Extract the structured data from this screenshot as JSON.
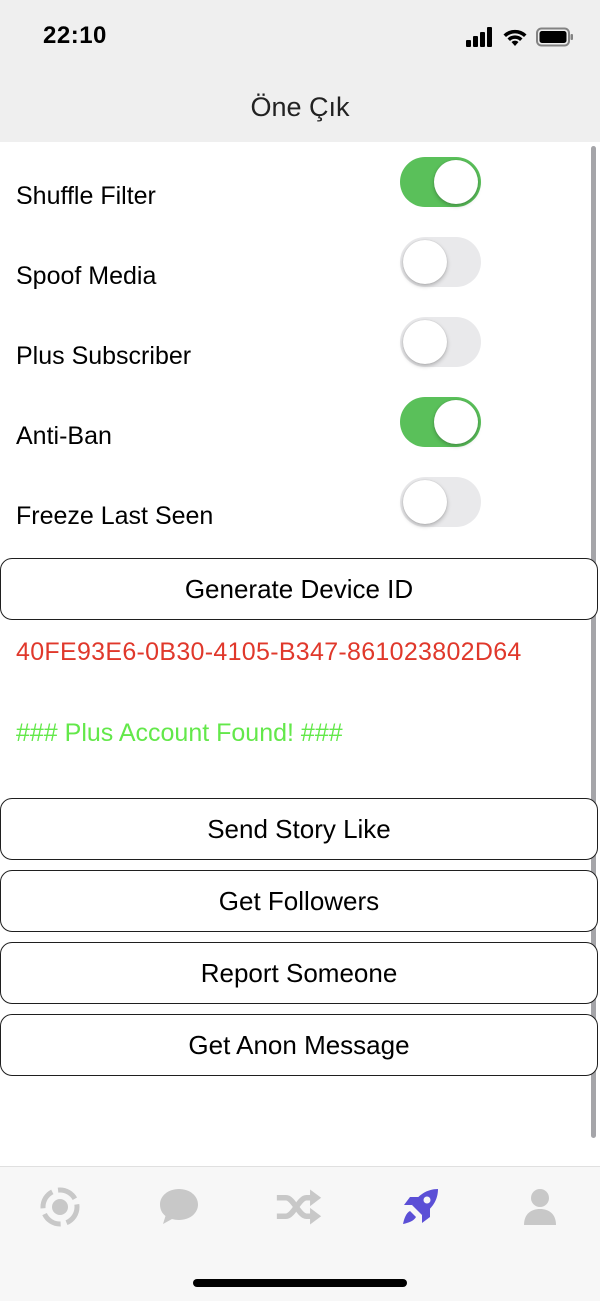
{
  "status": {
    "time": "22:10"
  },
  "nav": {
    "title": "Öne Çık"
  },
  "toggles": [
    {
      "label": "Shuffle Filter",
      "on": true
    },
    {
      "label": "Spoof Media",
      "on": false
    },
    {
      "label": "Plus Subscriber",
      "on": false
    },
    {
      "label": "Anti-Ban",
      "on": true
    },
    {
      "label": "Freeze Last Seen",
      "on": false
    }
  ],
  "generate_button": "Generate Device ID",
  "device_id": "40FE93E6-0B30-4105-B347-861023802D64",
  "plus_status": "### Plus Account Found! ###",
  "actions": {
    "send_story_like": "Send Story Like",
    "get_followers": "Get Followers",
    "report_someone": "Report Someone",
    "get_anon_message": "Get Anon Message"
  },
  "colors": {
    "toggle_on": "#5ac05a",
    "toggle_off": "#e9e9eb",
    "device_id": "#e0382b",
    "plus_status": "#63e84a",
    "tab_active": "#5b4fd6",
    "tab_inactive": "#c8c8c8"
  },
  "tabs": [
    {
      "icon": "radar-icon",
      "active": false
    },
    {
      "icon": "chat-bubble-icon",
      "active": false
    },
    {
      "icon": "shuffle-icon",
      "active": false
    },
    {
      "icon": "rocket-icon",
      "active": true
    },
    {
      "icon": "user-icon",
      "active": false
    }
  ]
}
